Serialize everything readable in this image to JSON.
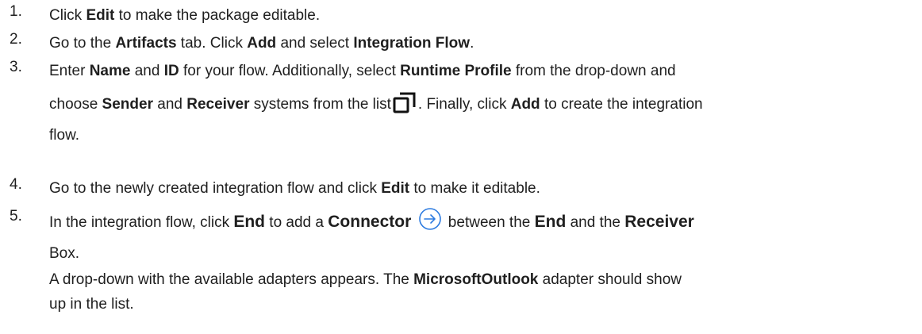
{
  "steps": [
    {
      "num": "1.",
      "parts": [
        "Click ",
        "Edit",
        " to make the package editable."
      ]
    },
    {
      "num": "2.",
      "parts": [
        "Go to the ",
        "Artifacts",
        " tab. Click ",
        "Add",
        " and select ",
        "Integration Flow",
        "."
      ]
    },
    {
      "num": "3.",
      "line1": [
        "Enter ",
        "Name",
        " and ",
        "ID",
        " for your flow. Additionally, select ",
        "Runtime Profile",
        " from the drop-down and"
      ],
      "line2": [
        "choose ",
        "Sender",
        " and ",
        "Receiver",
        " systems from the list",
        ". Finally, click ",
        "Add",
        " to create the integration"
      ],
      "line3": "flow.",
      "icon": "copy-list-icon"
    },
    {
      "num": "4.",
      "parts": [
        "Go to the newly created integration flow and click ",
        "Edit",
        " to make it editable."
      ]
    },
    {
      "num": "5.",
      "line1": [
        "In the integration flow, click ",
        "End",
        " to add a ",
        "Connector",
        " between the ",
        "End",
        " and the ",
        "Receiver"
      ],
      "line2": "Box.",
      "line3": [
        "A drop-down with the available adapters appears. The ",
        "MicrosoftOutlook",
        " adapter should show"
      ],
      "line4": "up in the list.",
      "icon": "arrow-circle-icon"
    }
  ]
}
